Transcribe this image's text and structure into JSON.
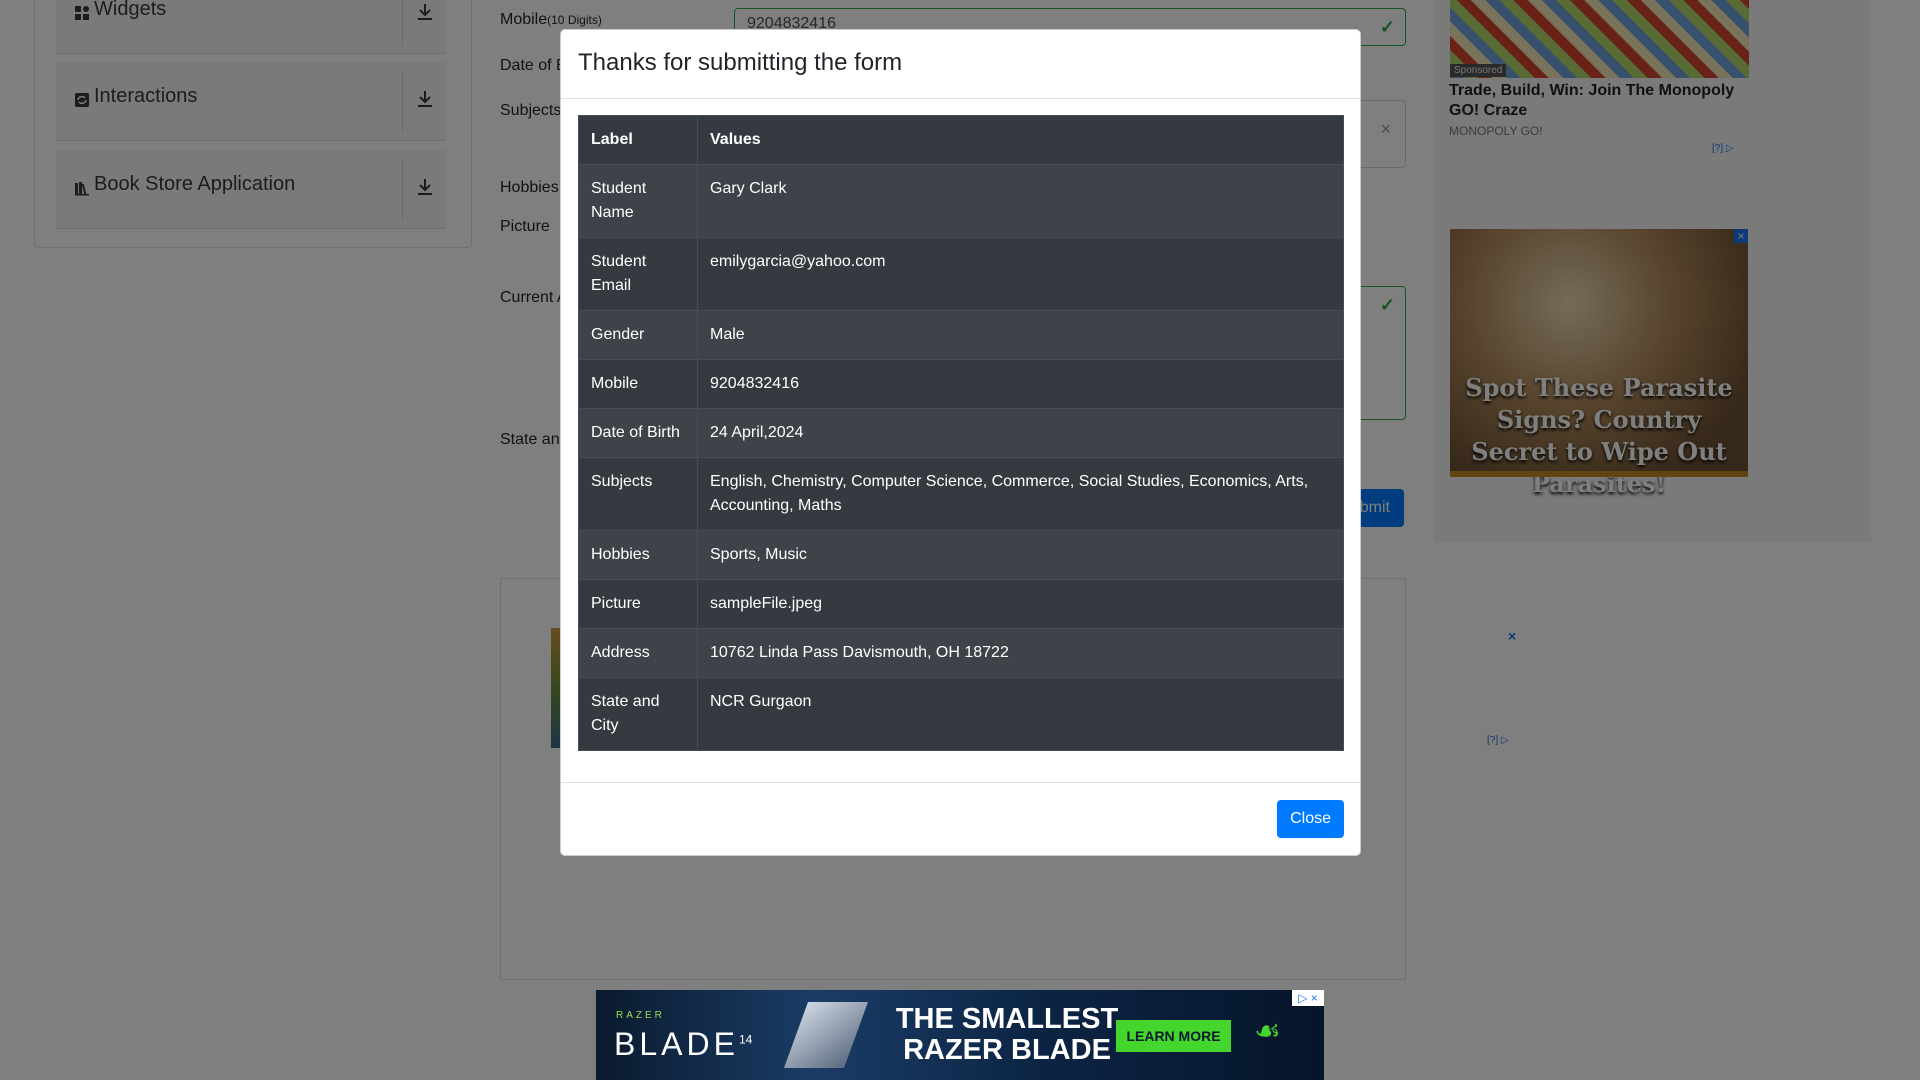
{
  "sidebar": {
    "groups": [
      {
        "name": "Widgets",
        "icon": "widgets-icon"
      },
      {
        "name": "Interactions",
        "icon": "interactions-icon"
      },
      {
        "name": "Book Store Application",
        "icon": "book-icon"
      }
    ]
  },
  "form": {
    "mobile_label": "Mobile",
    "mobile_hint": "(10 Digits)",
    "mobile_value": "9204832416",
    "dob_label": "Date of B",
    "subjects_label": "Subjects",
    "hobbies_label": "Hobbies",
    "picture_label": "Picture",
    "address_label": "Current A",
    "state_label": "State an",
    "submit_label": "ubmit"
  },
  "ads": {
    "sponsored": "Sponsored",
    "monopoly_title": "Trade, Build, Win: Join The Monopoly GO! Craze",
    "monopoly_source": "MONOPOLY GO!",
    "adchoice_label": "[?]",
    "sprout_text": "Spot These Parasite Signs? Country Secret to Wipe Out Parasites!",
    "banner": {
      "brand_small": "RAZER",
      "product": "BLADE",
      "product_size": "14",
      "headline": "THE SMALLEST RAZER BLADE",
      "cta": "LEARN MORE"
    }
  },
  "modal": {
    "title": "Thanks for submitting the form",
    "headers": [
      "Label",
      "Values"
    ],
    "rows": [
      {
        "label": "Student Name",
        "value": "Gary Clark"
      },
      {
        "label": "Student Email",
        "value": "emilygarcia@yahoo.com"
      },
      {
        "label": "Gender",
        "value": "Male"
      },
      {
        "label": "Mobile",
        "value": "9204832416"
      },
      {
        "label": "Date of Birth",
        "value": "24 April,2024"
      },
      {
        "label": "Subjects",
        "value": "English, Chemistry, Computer Science, Commerce, Social Studies, Economics, Arts, Accounting, Maths"
      },
      {
        "label": "Hobbies",
        "value": "Sports, Music"
      },
      {
        "label": "Picture",
        "value": "sampleFile.jpeg"
      },
      {
        "label": "Address",
        "value": "10762 Linda Pass Davismouth, OH 18722"
      },
      {
        "label": "State and City",
        "value": "NCR Gurgaon"
      }
    ],
    "close_label": "Close"
  },
  "colors": {
    "primary": "#007bff",
    "valid": "#28a745",
    "table_dark": "#343a40"
  }
}
